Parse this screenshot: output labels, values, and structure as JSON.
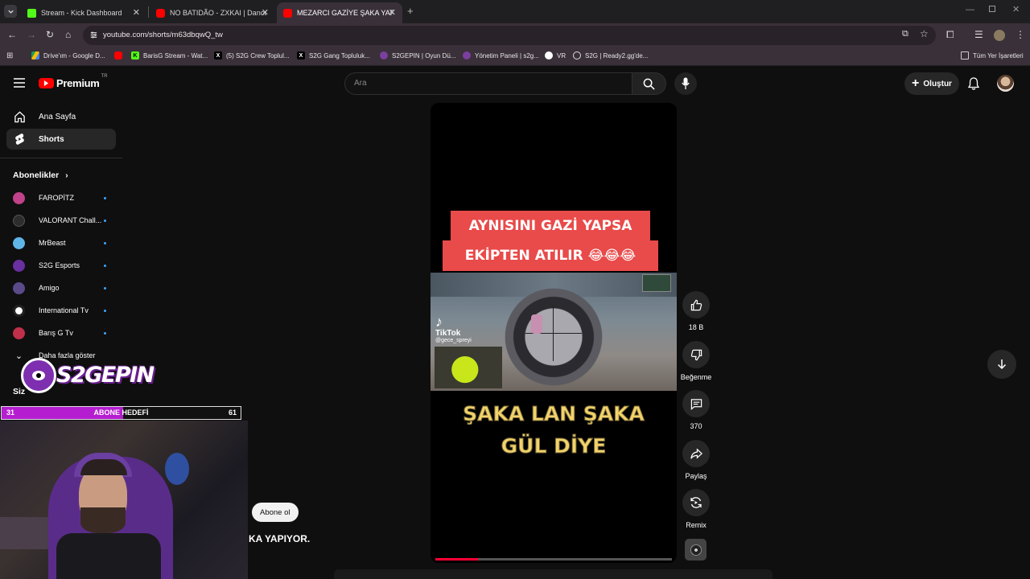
{
  "browser": {
    "tabs": [
      {
        "title": "Stream - Kick Dashboard",
        "icon": "kick-icon",
        "color": "#53fc18"
      },
      {
        "title": "NO BATIDÃO - ZXKAI | Dance c",
        "icon": "youtube-icon",
        "color": "#ff0000"
      },
      {
        "title": "MEZARCI GAZİYE ŞAKA YAPIYO",
        "icon": "youtube-icon",
        "color": "#ff0000"
      }
    ],
    "new_tab": "+",
    "url": "youtube.com/shorts/m63dbqwQ_tw",
    "bookmarks": [
      {
        "label": "Drive'ım - Google D...",
        "icon": "drive-icon",
        "color": "#fbbc04"
      },
      {
        "label": "",
        "icon": "youtube-icon",
        "color": "#ff0000"
      },
      {
        "label": "BarisG Stream - Wat...",
        "icon": "kick-icon",
        "color": "#53fc18"
      },
      {
        "label": "(5) S2G Crew Toplul...",
        "icon": "x-icon",
        "color": "#000000"
      },
      {
        "label": "S2G Gang Topluluk...",
        "icon": "x-icon",
        "color": "#000000"
      },
      {
        "label": "S2GEPIN | Oyun Dü...",
        "icon": "s2g-icon",
        "color": "#7b3fa0"
      },
      {
        "label": "Yönetim Paneli | s2g...",
        "icon": "s2g-icon",
        "color": "#7b3fa0"
      },
      {
        "label": "VR",
        "icon": "vr-icon",
        "color": "#ffffff"
      },
      {
        "label": "S2G | Ready2.gg'de...",
        "icon": "globe-icon",
        "color": "#ffffff"
      }
    ],
    "all_bookmarks": "Tüm Yer İşaretleri"
  },
  "youtube": {
    "logo_text": "Premium",
    "logo_sup": "TR",
    "search_placeholder": "Ara",
    "create_label": "Oluştur",
    "sidebar": {
      "items": [
        {
          "label": "Ana Sayfa",
          "icon": "home-icon"
        },
        {
          "label": "Shorts",
          "icon": "shorts-icon"
        }
      ],
      "subscriptions_title": "Abonelikler",
      "subscriptions": [
        {
          "label": "FAROPİTZ",
          "color": "#c0428a"
        },
        {
          "label": "VALORANT Chall...",
          "color": "#2d2d2d"
        },
        {
          "label": "MrBeast",
          "color": "#5fb5e8"
        },
        {
          "label": "S2G Esports",
          "color": "#6a2fa0"
        },
        {
          "label": "Amigo",
          "color": "#5a4a8a"
        },
        {
          "label": "International Tv",
          "color": "#ffffff"
        },
        {
          "label": "Barış G Tv",
          "color": "#c0304a"
        }
      ],
      "show_more": "Daha fazla göster",
      "you_label": "Siz"
    },
    "short": {
      "banner_line1": "AYNISINI GAZİ YAPSA",
      "banner_line2": "EKİPTEN ATILIR 😂😂😂",
      "tiktok_label": "TikTok",
      "tiktok_user": "@gece_spreyi",
      "bottom_line1": "ŞAKA LAN ŞAKA",
      "bottom_line2": "GÜL DİYE",
      "progress": 0.18
    },
    "actions": {
      "like_count": "18 B",
      "dislike_label": "Beğenme",
      "comment_count": "370",
      "share_label": "Paylaş",
      "remix_label": "Remix"
    },
    "subscribe_label": "Abone ol",
    "title_fragment": "KA YAPIYOR."
  },
  "stream_overlay": {
    "brand": "S2GEPIN",
    "goal_current": "31",
    "goal_label": "ABONE HEDEFİ",
    "goal_target": "61",
    "goal_fraction": 0.508
  }
}
